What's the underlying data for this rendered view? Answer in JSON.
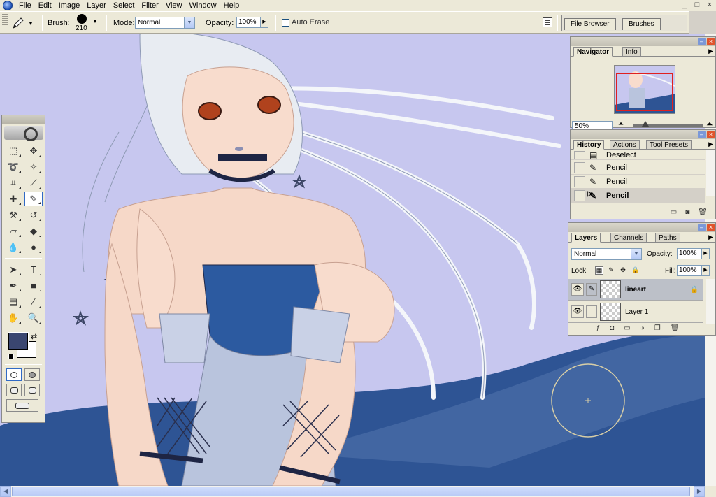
{
  "menubar": {
    "items": [
      "File",
      "Edit",
      "Image",
      "Layer",
      "Select",
      "Filter",
      "View",
      "Window",
      "Help"
    ],
    "window_controls": [
      "_",
      "□",
      "×"
    ]
  },
  "options_bar": {
    "brush_label": "Brush:",
    "brush_size": "210",
    "mode_label": "Mode:",
    "mode_value": "Normal",
    "opacity_label": "Opacity:",
    "opacity_value": "100%",
    "auto_erase_label": "Auto Erase",
    "auto_erase_checked": false,
    "palette_well_tabs": [
      "File Browser",
      "Brushes"
    ]
  },
  "toolbox": {
    "foreground_color": "#3a4670",
    "background_color": "#ffffff"
  },
  "navigator": {
    "tabs": [
      "Navigator",
      "Info"
    ],
    "zoom": "50%"
  },
  "history": {
    "tabs": [
      "History",
      "Actions",
      "Tool Presets"
    ],
    "items": [
      {
        "label": "Deselect",
        "icon": "deselect-icon"
      },
      {
        "label": "Pencil",
        "icon": "pencil-icon"
      },
      {
        "label": "Pencil",
        "icon": "pencil-icon"
      },
      {
        "label": "Pencil",
        "icon": "pencil-icon"
      }
    ]
  },
  "layers": {
    "tabs": [
      "Layers",
      "Channels",
      "Paths"
    ],
    "blend_mode": "Normal",
    "opacity_label": "Opacity:",
    "opacity_value": "100%",
    "lock_label": "Lock:",
    "fill_label": "Fill:",
    "fill_value": "100%",
    "items": [
      {
        "name": "lineart",
        "selected": true,
        "locked": true
      },
      {
        "name": "Layer 1",
        "selected": false,
        "locked": false
      }
    ]
  },
  "colors": {
    "accent": "#316ac5",
    "canvas_bg": "#c7c7ef",
    "dress_blue": "#2e5494",
    "chrome": "#ece9d8"
  }
}
